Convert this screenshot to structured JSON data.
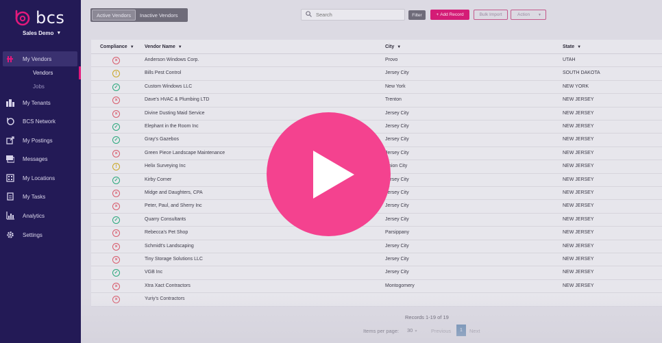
{
  "brand": {
    "logo_text": "bcs",
    "org_name": "Sales Demo",
    "accent": "#e2197c"
  },
  "sidebar": {
    "items": [
      {
        "label": "My Vendors",
        "icon": "vendors-icon",
        "active": true
      },
      {
        "label": "My Tenants",
        "icon": "tenants-icon"
      },
      {
        "label": "BCS Network",
        "icon": "network-icon"
      },
      {
        "label": "My Postings",
        "icon": "postings-icon"
      },
      {
        "label": "Messages",
        "icon": "messages-icon"
      },
      {
        "label": "My Locations",
        "icon": "locations-icon"
      },
      {
        "label": "My Tasks",
        "icon": "tasks-icon"
      },
      {
        "label": "Analytics",
        "icon": "analytics-icon"
      },
      {
        "label": "Settings",
        "icon": "settings-icon"
      }
    ],
    "subitems": [
      {
        "label": "Vendors",
        "active": true
      },
      {
        "label": "Jobs"
      }
    ]
  },
  "toolbar": {
    "toggle_active": "Active Vendors",
    "toggle_inactive": "Inactive Vendors",
    "search_placeholder": "Search",
    "filter_label": "Filter",
    "add_record_label": "Add Record",
    "bulk_import_label": "Bulk Import",
    "action_label": "Action"
  },
  "table": {
    "columns": [
      "Compliance",
      "Vendor Name",
      "City",
      "State"
    ],
    "rows": [
      {
        "status": "bad",
        "name": "Anderson Windows Corp.",
        "city": "Provo",
        "state": "UTAH"
      },
      {
        "status": "warn",
        "name": "Bills Pest Control",
        "city": "Jersey City",
        "state": "SOUTH DAKOTA"
      },
      {
        "status": "ok",
        "name": "Custom Windows LLC",
        "city": "New York",
        "state": "NEW YORK"
      },
      {
        "status": "bad",
        "name": "Dave's HVAC & Plumbing LTD",
        "city": "Trenton",
        "state": "NEW JERSEY"
      },
      {
        "status": "bad",
        "name": "Divine Dusting Maid Service",
        "city": "Jersey City",
        "state": "NEW JERSEY"
      },
      {
        "status": "ok",
        "name": "Elephant in the Room Inc",
        "city": "Jersey City",
        "state": "NEW JERSEY"
      },
      {
        "status": "ok",
        "name": "Gray's Gazebos",
        "city": "Jersey City",
        "state": "NEW JERSEY"
      },
      {
        "status": "bad",
        "name": "Green Piece Landscape Maintenance",
        "city": "Jersey City",
        "state": "NEW JERSEY"
      },
      {
        "status": "warn",
        "name": "Helix Surveying Inc",
        "city": "Union City",
        "state": "NEW JERSEY"
      },
      {
        "status": "ok",
        "name": "Kirby Corner",
        "city": "Jersey City",
        "state": "NEW JERSEY"
      },
      {
        "status": "bad",
        "name": "Midge and Daughters, CPA",
        "city": "Jersey City",
        "state": "NEW JERSEY"
      },
      {
        "status": "bad",
        "name": "Peter, Paul, and Sherry Inc",
        "city": "Jersey City",
        "state": "NEW JERSEY"
      },
      {
        "status": "ok",
        "name": "Quarry Consultants",
        "city": "Jersey City",
        "state": "NEW JERSEY"
      },
      {
        "status": "bad",
        "name": "Rebecca's Pet Shop",
        "city": "Parsippany",
        "state": "NEW JERSEY"
      },
      {
        "status": "bad",
        "name": "Schmidt's Landscaping",
        "city": "Jersey City",
        "state": "NEW JERSEY"
      },
      {
        "status": "bad",
        "name": "Tiny Storage Solutions LLC",
        "city": "Jersey City",
        "state": "NEW JERSEY"
      },
      {
        "status": "ok",
        "name": "VGB Inc",
        "city": "Jersey City",
        "state": "NEW JERSEY"
      },
      {
        "status": "bad",
        "name": "Xtra Xact Contractors",
        "city": "Montogomery",
        "state": "NEW JERSEY"
      },
      {
        "status": "bad",
        "name": "Yuriy's Contractors",
        "city": "",
        "state": ""
      }
    ]
  },
  "pagination": {
    "records_text": "Records 1-19 of 19",
    "items_per_page_label": "Items per page:",
    "items_per_page_value": "30",
    "previous_label": "Previous",
    "current_page": "1",
    "next_label": "Next"
  },
  "video_overlay": {
    "icon": "play-icon",
    "color": "#f4428f"
  }
}
